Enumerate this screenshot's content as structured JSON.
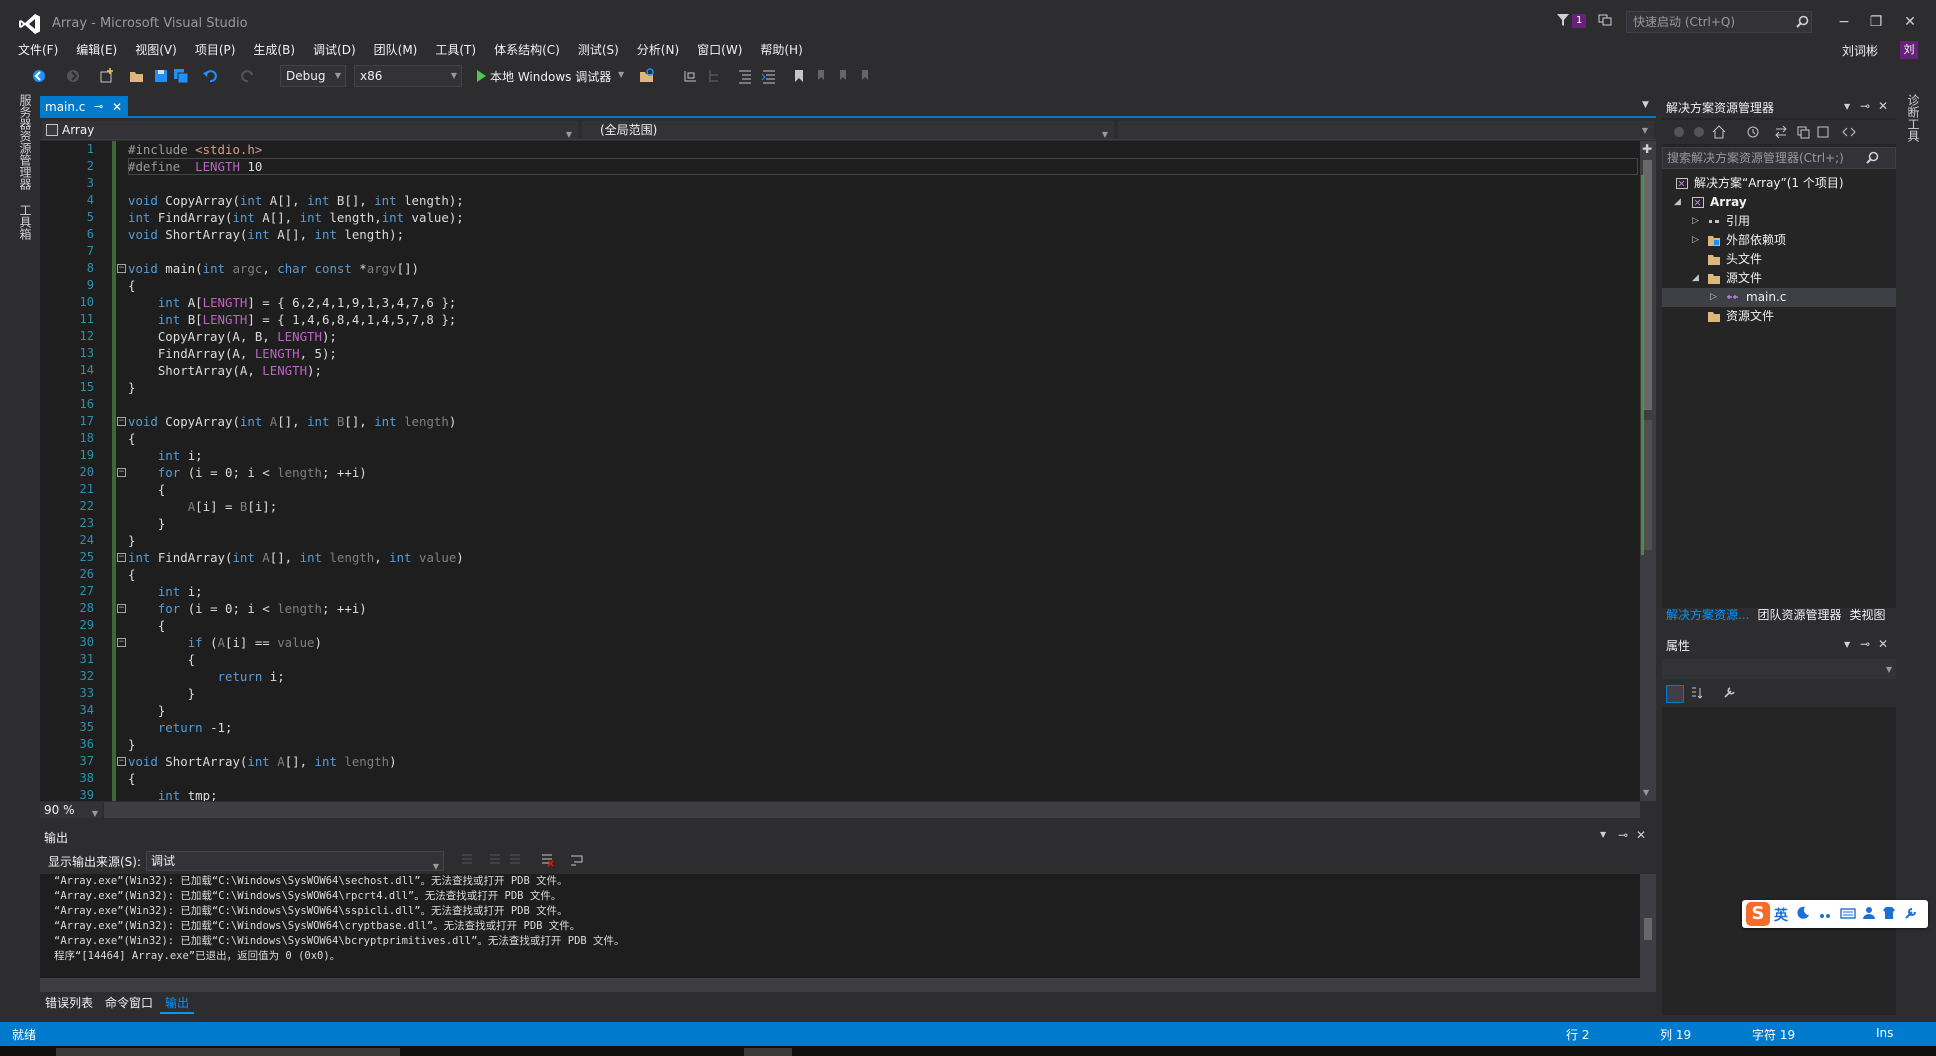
{
  "window": {
    "title": "Array - Microsoft Visual Studio",
    "notification_count": "1",
    "quick_launch_placeholder": "快速启动 (Ctrl+Q)",
    "user_name": "刘词彬",
    "user_initial": "刘",
    "minimize": "−",
    "maximize": "❐",
    "close": "✕"
  },
  "menu": [
    "文件(F)",
    "编辑(E)",
    "视图(V)",
    "项目(P)",
    "生成(B)",
    "调试(D)",
    "团队(M)",
    "工具(T)",
    "体系结构(C)",
    "测试(S)",
    "分析(N)",
    "窗口(W)",
    "帮助(H)"
  ],
  "toolbar": {
    "configuration": "Debug",
    "platform": "x86",
    "start_debugger": "本地 Windows 调试器"
  },
  "left_strip": {
    "server_explorer": "服务器资源管理器",
    "toolbox": "工具箱"
  },
  "right_strip": {
    "diagnostic_tools": "诊断工具"
  },
  "editor": {
    "tab_label": "main.c",
    "nav_project": "Array",
    "nav_scope": "(全局范围)",
    "zoom": "90 %",
    "line_numbers": [
      "1",
      "2",
      "3",
      "4",
      "5",
      "6",
      "7",
      "8",
      "9",
      "10",
      "11",
      "12",
      "13",
      "14",
      "15",
      "16",
      "17",
      "18",
      "19",
      "20",
      "21",
      "22",
      "23",
      "24",
      "25",
      "26",
      "27",
      "28",
      "29",
      "30",
      "31",
      "32",
      "33",
      "34",
      "35",
      "36",
      "37",
      "38",
      "39"
    ],
    "code": [
      [
        [
          "pp",
          "#include "
        ],
        [
          "str",
          "<stdio.h>"
        ]
      ],
      [
        [
          "pp",
          "#define  "
        ],
        [
          "mac",
          "LENGTH"
        ],
        [
          "",
          " 10"
        ]
      ],
      [],
      [
        [
          "kw",
          "void"
        ],
        [
          "",
          " CopyArray("
        ],
        [
          "kw",
          "int"
        ],
        [
          "",
          " A[], "
        ],
        [
          "kw",
          "int"
        ],
        [
          "",
          " B[], "
        ],
        [
          "kw",
          "int"
        ],
        [
          "",
          " length);"
        ]
      ],
      [
        [
          "kw",
          "int"
        ],
        [
          "",
          " FindArray("
        ],
        [
          "kw",
          "int"
        ],
        [
          "",
          " A[], "
        ],
        [
          "kw",
          "int"
        ],
        [
          "",
          " length,"
        ],
        [
          "kw",
          "int"
        ],
        [
          "",
          " value);"
        ]
      ],
      [
        [
          "kw",
          "void"
        ],
        [
          "",
          " ShortArray("
        ],
        [
          "kw",
          "int"
        ],
        [
          "",
          " A[], "
        ],
        [
          "kw",
          "int"
        ],
        [
          "",
          " length);"
        ]
      ],
      [],
      [
        [
          "kw",
          "void"
        ],
        [
          "",
          " main("
        ],
        [
          "kw",
          "int"
        ],
        [
          "prm",
          " argc"
        ],
        [
          "",
          ", "
        ],
        [
          "kw",
          "char const"
        ],
        [
          "",
          " *"
        ],
        [
          "prm",
          "argv"
        ],
        [
          "",
          "[])"
        ]
      ],
      [
        [
          "",
          "{"
        ]
      ],
      [
        [
          "",
          "    "
        ],
        [
          "kw",
          "int"
        ],
        [
          "",
          " A["
        ],
        [
          "mac",
          "LENGTH"
        ],
        [
          "",
          "] = { 6,2,4,1,9,1,3,4,7,6 };"
        ]
      ],
      [
        [
          "",
          "    "
        ],
        [
          "kw",
          "int"
        ],
        [
          "",
          " B["
        ],
        [
          "mac",
          "LENGTH"
        ],
        [
          "",
          "] = { 1,4,6,8,4,1,4,5,7,8 };"
        ]
      ],
      [
        [
          "",
          "    CopyArray(A, B, "
        ],
        [
          "mac",
          "LENGTH"
        ],
        [
          "",
          ");"
        ]
      ],
      [
        [
          "",
          "    FindArray(A, "
        ],
        [
          "mac",
          "LENGTH"
        ],
        [
          "",
          ", 5);"
        ]
      ],
      [
        [
          "",
          "    ShortArray(A, "
        ],
        [
          "mac",
          "LENGTH"
        ],
        [
          "",
          ");"
        ]
      ],
      [
        [
          "",
          "}"
        ]
      ],
      [],
      [
        [
          "kw",
          "void"
        ],
        [
          "",
          " CopyArray("
        ],
        [
          "kw",
          "int"
        ],
        [
          "prm",
          " A"
        ],
        [
          "",
          "[], "
        ],
        [
          "kw",
          "int"
        ],
        [
          "prm",
          " B"
        ],
        [
          "",
          "[], "
        ],
        [
          "kw",
          "int"
        ],
        [
          "prm",
          " length"
        ],
        [
          "",
          ")"
        ]
      ],
      [
        [
          "",
          "{"
        ]
      ],
      [
        [
          "",
          "    "
        ],
        [
          "kw",
          "int"
        ],
        [
          "",
          " i;"
        ]
      ],
      [
        [
          "",
          "    "
        ],
        [
          "kw",
          "for"
        ],
        [
          "",
          " (i = 0; i < "
        ],
        [
          "prm",
          "length"
        ],
        [
          "",
          "; ++i)"
        ]
      ],
      [
        [
          "",
          "    {"
        ]
      ],
      [
        [
          "",
          "        "
        ],
        [
          "prm",
          "A"
        ],
        [
          "",
          "[i] = "
        ],
        [
          "prm",
          "B"
        ],
        [
          "",
          "[i];"
        ]
      ],
      [
        [
          "",
          "    }"
        ]
      ],
      [
        [
          "",
          "}"
        ]
      ],
      [
        [
          "kw",
          "int"
        ],
        [
          "",
          " FindArray("
        ],
        [
          "kw",
          "int"
        ],
        [
          "prm",
          " A"
        ],
        [
          "",
          "[], "
        ],
        [
          "kw",
          "int"
        ],
        [
          "prm",
          " length"
        ],
        [
          "",
          ", "
        ],
        [
          "kw",
          "int"
        ],
        [
          "prm",
          " value"
        ],
        [
          "",
          ")"
        ]
      ],
      [
        [
          "",
          "{"
        ]
      ],
      [
        [
          "",
          "    "
        ],
        [
          "kw",
          "int"
        ],
        [
          "",
          " i;"
        ]
      ],
      [
        [
          "",
          "    "
        ],
        [
          "kw",
          "for"
        ],
        [
          "",
          " (i = 0; i < "
        ],
        [
          "prm",
          "length"
        ],
        [
          "",
          "; ++i)"
        ]
      ],
      [
        [
          "",
          "    {"
        ]
      ],
      [
        [
          "",
          "        "
        ],
        [
          "kw",
          "if"
        ],
        [
          "",
          " ("
        ],
        [
          "prm",
          "A"
        ],
        [
          "",
          "[i] == "
        ],
        [
          "prm",
          "value"
        ],
        [
          "",
          ")"
        ]
      ],
      [
        [
          "",
          "        {"
        ]
      ],
      [
        [
          "",
          "            "
        ],
        [
          "kw",
          "return"
        ],
        [
          "",
          " i;"
        ]
      ],
      [
        [
          "",
          "        }"
        ]
      ],
      [
        [
          "",
          "    }"
        ]
      ],
      [
        [
          "",
          "    "
        ],
        [
          "kw",
          "return"
        ],
        [
          "",
          " -1;"
        ]
      ],
      [
        [
          "",
          "}"
        ]
      ],
      [
        [
          "kw",
          "void"
        ],
        [
          "",
          " ShortArray("
        ],
        [
          "kw",
          "int"
        ],
        [
          "prm",
          " A"
        ],
        [
          "",
          "[], "
        ],
        [
          "kw",
          "int"
        ],
        [
          "prm",
          " length"
        ],
        [
          "",
          ")"
        ]
      ],
      [
        [
          "",
          "{"
        ]
      ],
      [
        [
          "",
          "    "
        ],
        [
          "kw",
          "int"
        ],
        [
          "",
          " tmp;"
        ]
      ]
    ]
  },
  "output": {
    "title": "输出",
    "source_label": "显示输出来源(S):",
    "source_value": "调试",
    "lines": [
      "“Array.exe”(Win32): 已加载“C:\\Windows\\SysWOW64\\sechost.dll”。无法查找或打开 PDB 文件。",
      "“Array.exe”(Win32): 已加载“C:\\Windows\\SysWOW64\\rpcrt4.dll”。无法查找或打开 PDB 文件。",
      "“Array.exe”(Win32): 已加载“C:\\Windows\\SysWOW64\\sspicli.dll”。无法查找或打开 PDB 文件。",
      "“Array.exe”(Win32): 已加载“C:\\Windows\\SysWOW64\\cryptbase.dll”。无法查找或打开 PDB 文件。",
      "“Array.exe”(Win32): 已加载“C:\\Windows\\SysWOW64\\bcryptprimitives.dll”。无法查找或打开 PDB 文件。",
      "程序“[14464] Array.exe”已退出，返回值为 0 (0x0)。"
    ]
  },
  "bottom_tabs": [
    "错误列表",
    "命令窗口",
    "输出"
  ],
  "solution_explorer": {
    "title": "解决方案资源管理器",
    "search_placeholder": "搜索解决方案资源管理器(Ctrl+;)",
    "solution": "解决方案“Array”(1 个项目)",
    "project": "Array",
    "references": "引用",
    "external_deps": "外部依赖项",
    "headers": "头文件",
    "sources": "源文件",
    "main_file": "main.c",
    "resources": "资源文件",
    "tabs": [
      "解决方案资源...",
      "团队资源管理器",
      "类视图"
    ]
  },
  "properties": {
    "title": "属性"
  },
  "ime": {
    "logo": "S",
    "lang": "英"
  },
  "status": {
    "state": "就绪",
    "row": "行 2",
    "col": "列 19",
    "char": "字符 19",
    "mode": "Ins"
  },
  "colors": {
    "accent": "#007acc",
    "keyword": "#569cd6",
    "macro": "#bd63c5",
    "string": "#d69d85",
    "line_number": "#2b91af",
    "change_bar": "#57a64a"
  }
}
